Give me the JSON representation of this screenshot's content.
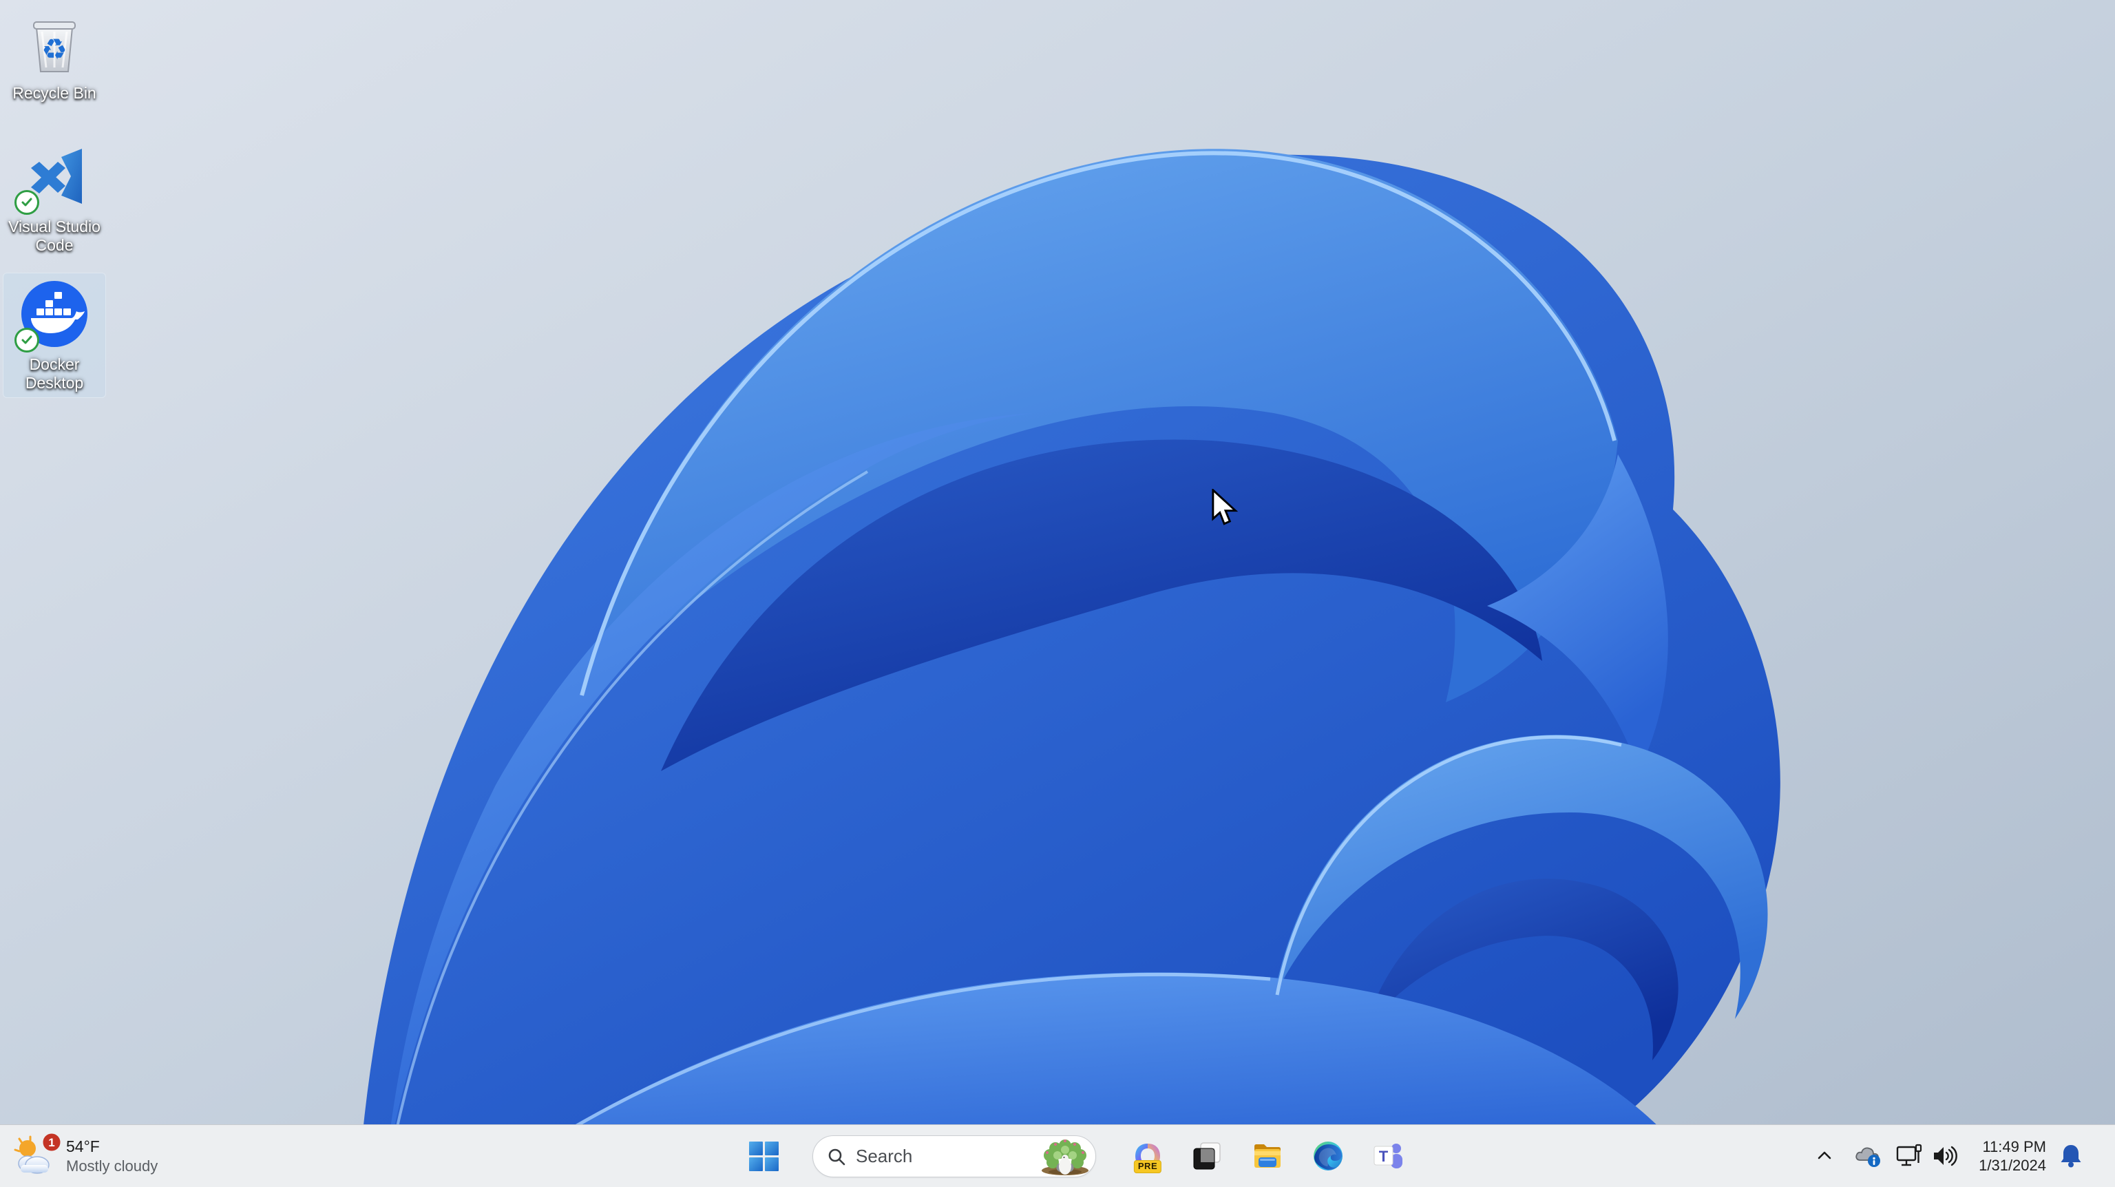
{
  "desktop": {
    "icons": [
      {
        "label": "Recycle Bin",
        "selected": false
      },
      {
        "label": "Visual Studio Code",
        "selected": false,
        "sync_status": "synced"
      },
      {
        "label": "Docker Desktop",
        "selected": true,
        "sync_status": "synced"
      }
    ]
  },
  "taskbar": {
    "widget": {
      "temperature": "54°F",
      "condition": "Mostly cloudy",
      "notification_count": "1"
    },
    "search": {
      "placeholder": "Search"
    },
    "copilot": {
      "badge": "PRE"
    },
    "apps": [
      {
        "name": "copilot"
      },
      {
        "name": "task-view"
      },
      {
        "name": "file-explorer"
      },
      {
        "name": "microsoft-edge"
      },
      {
        "name": "microsoft-teams"
      }
    ],
    "clock": {
      "time": "11:49 PM",
      "date": "1/31/2024"
    }
  },
  "icons": {
    "recycle_glyph": "♻",
    "teams_letter": "T"
  },
  "colors": {
    "taskbar_bg": "#edeff1",
    "docker_blue": "#1d63ed",
    "badge_red": "#c43425",
    "bell_blue": "#2456b4",
    "start_blue_light": "#53aeec",
    "start_blue_dark": "#1a67c6",
    "wallpaper_bg_light": "#d9e0ea",
    "wallpaper_bg_dark": "#b4c1d2",
    "bloom_deep": "#0f35a6",
    "bloom_bright": "#4f94ec"
  }
}
